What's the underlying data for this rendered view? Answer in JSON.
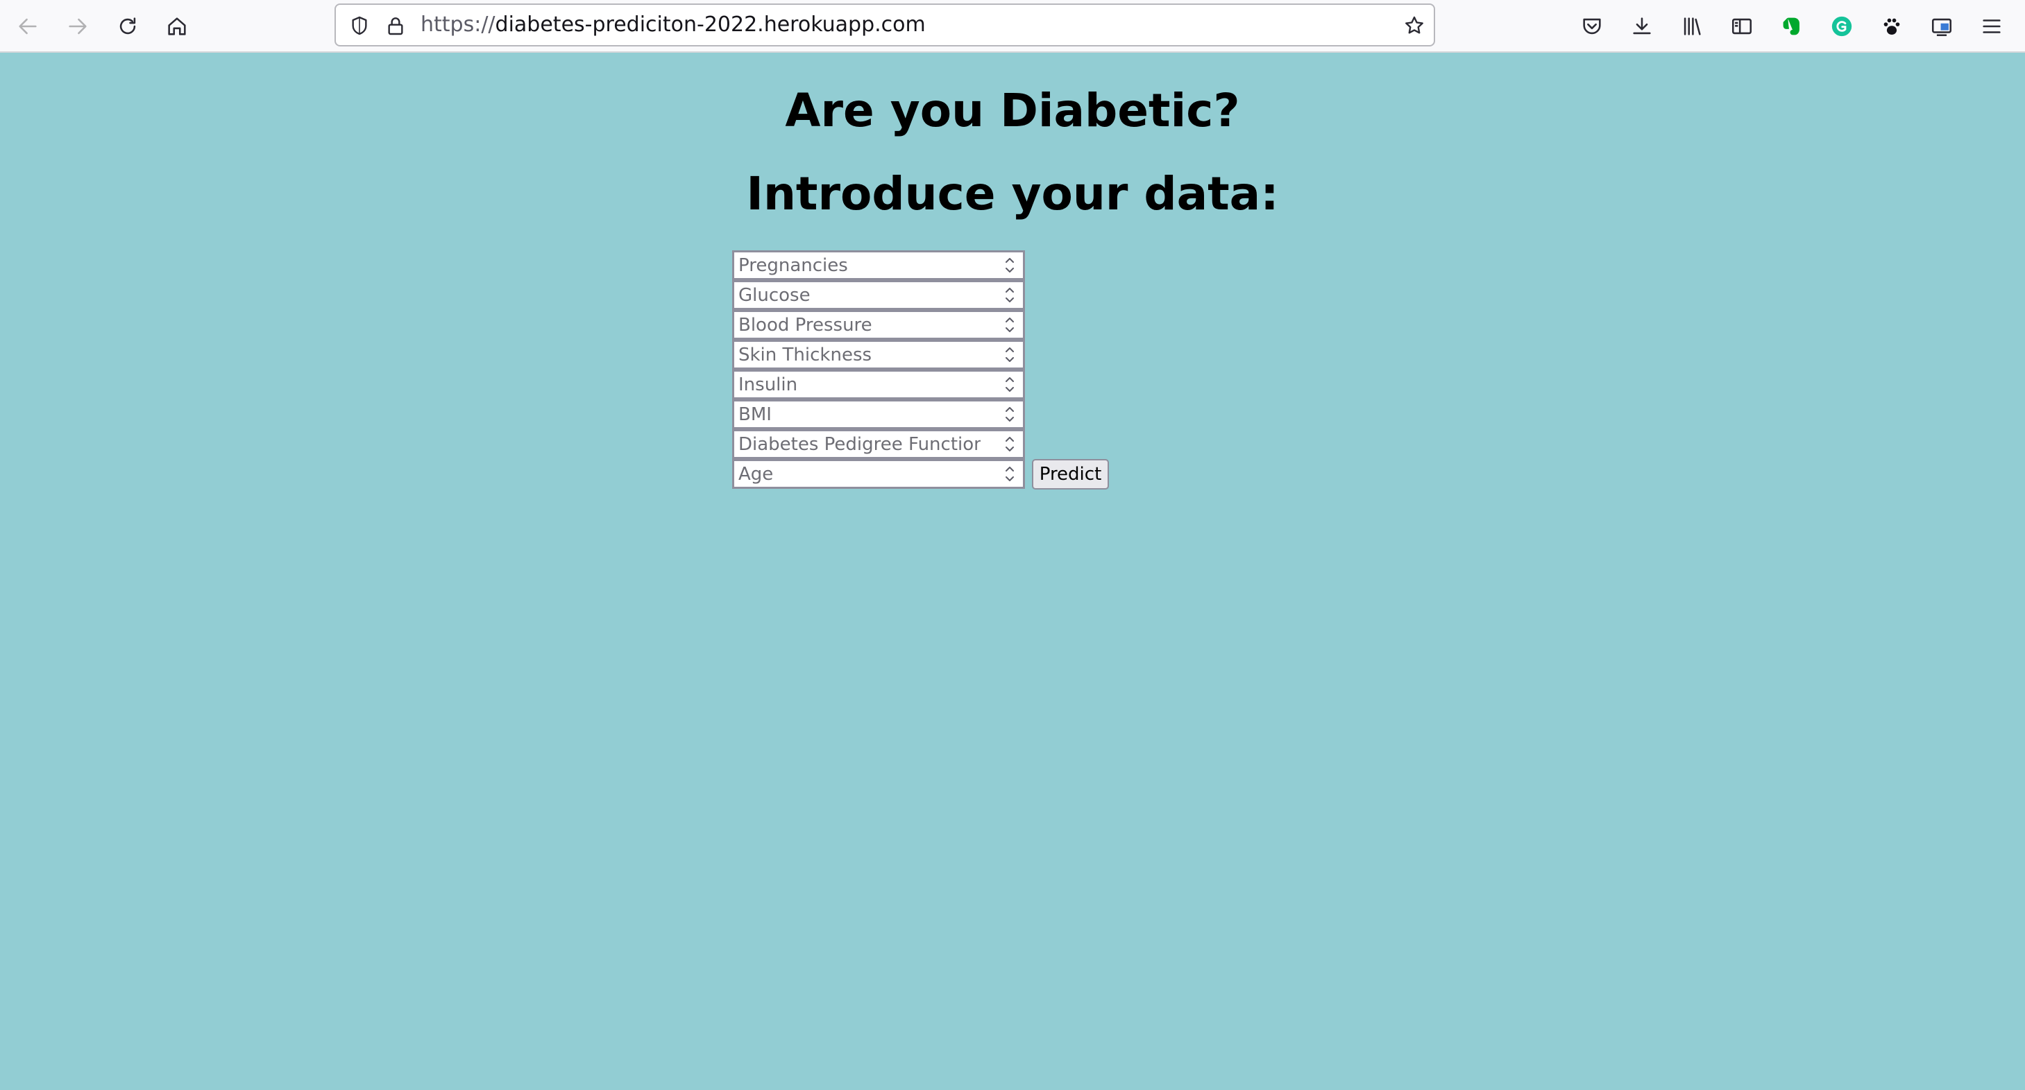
{
  "browser": {
    "url_scheme": "https://",
    "url_host": "diabetes-prediciton-2022.herokuapp.com",
    "nav_icons": [
      "back-arrow-icon",
      "forward-arrow-icon",
      "reload-icon",
      "home-icon"
    ],
    "url_icons": [
      "tracking-shield-icon",
      "lock-icon",
      "bookmark-star-icon"
    ],
    "toolbar_icons": [
      "pocket-icon",
      "downloads-icon",
      "library-icon",
      "sidebar-icon",
      "evernote-icon",
      "grammarly-icon",
      "extension-paw-icon",
      "screenshot-icon",
      "menu-icon"
    ]
  },
  "page": {
    "background": "#92cdd3",
    "title": "Are you Diabetic?",
    "subtitle": "Introduce your data:",
    "fields": [
      {
        "placeholder": "Pregnancies"
      },
      {
        "placeholder": "Glucose"
      },
      {
        "placeholder": "Blood Pressure"
      },
      {
        "placeholder": "Skin Thickness"
      },
      {
        "placeholder": "Insulin"
      },
      {
        "placeholder": "BMI"
      },
      {
        "placeholder": "Diabetes Pedigree Function"
      },
      {
        "placeholder": "Age"
      }
    ],
    "submit_label": "Predict"
  }
}
